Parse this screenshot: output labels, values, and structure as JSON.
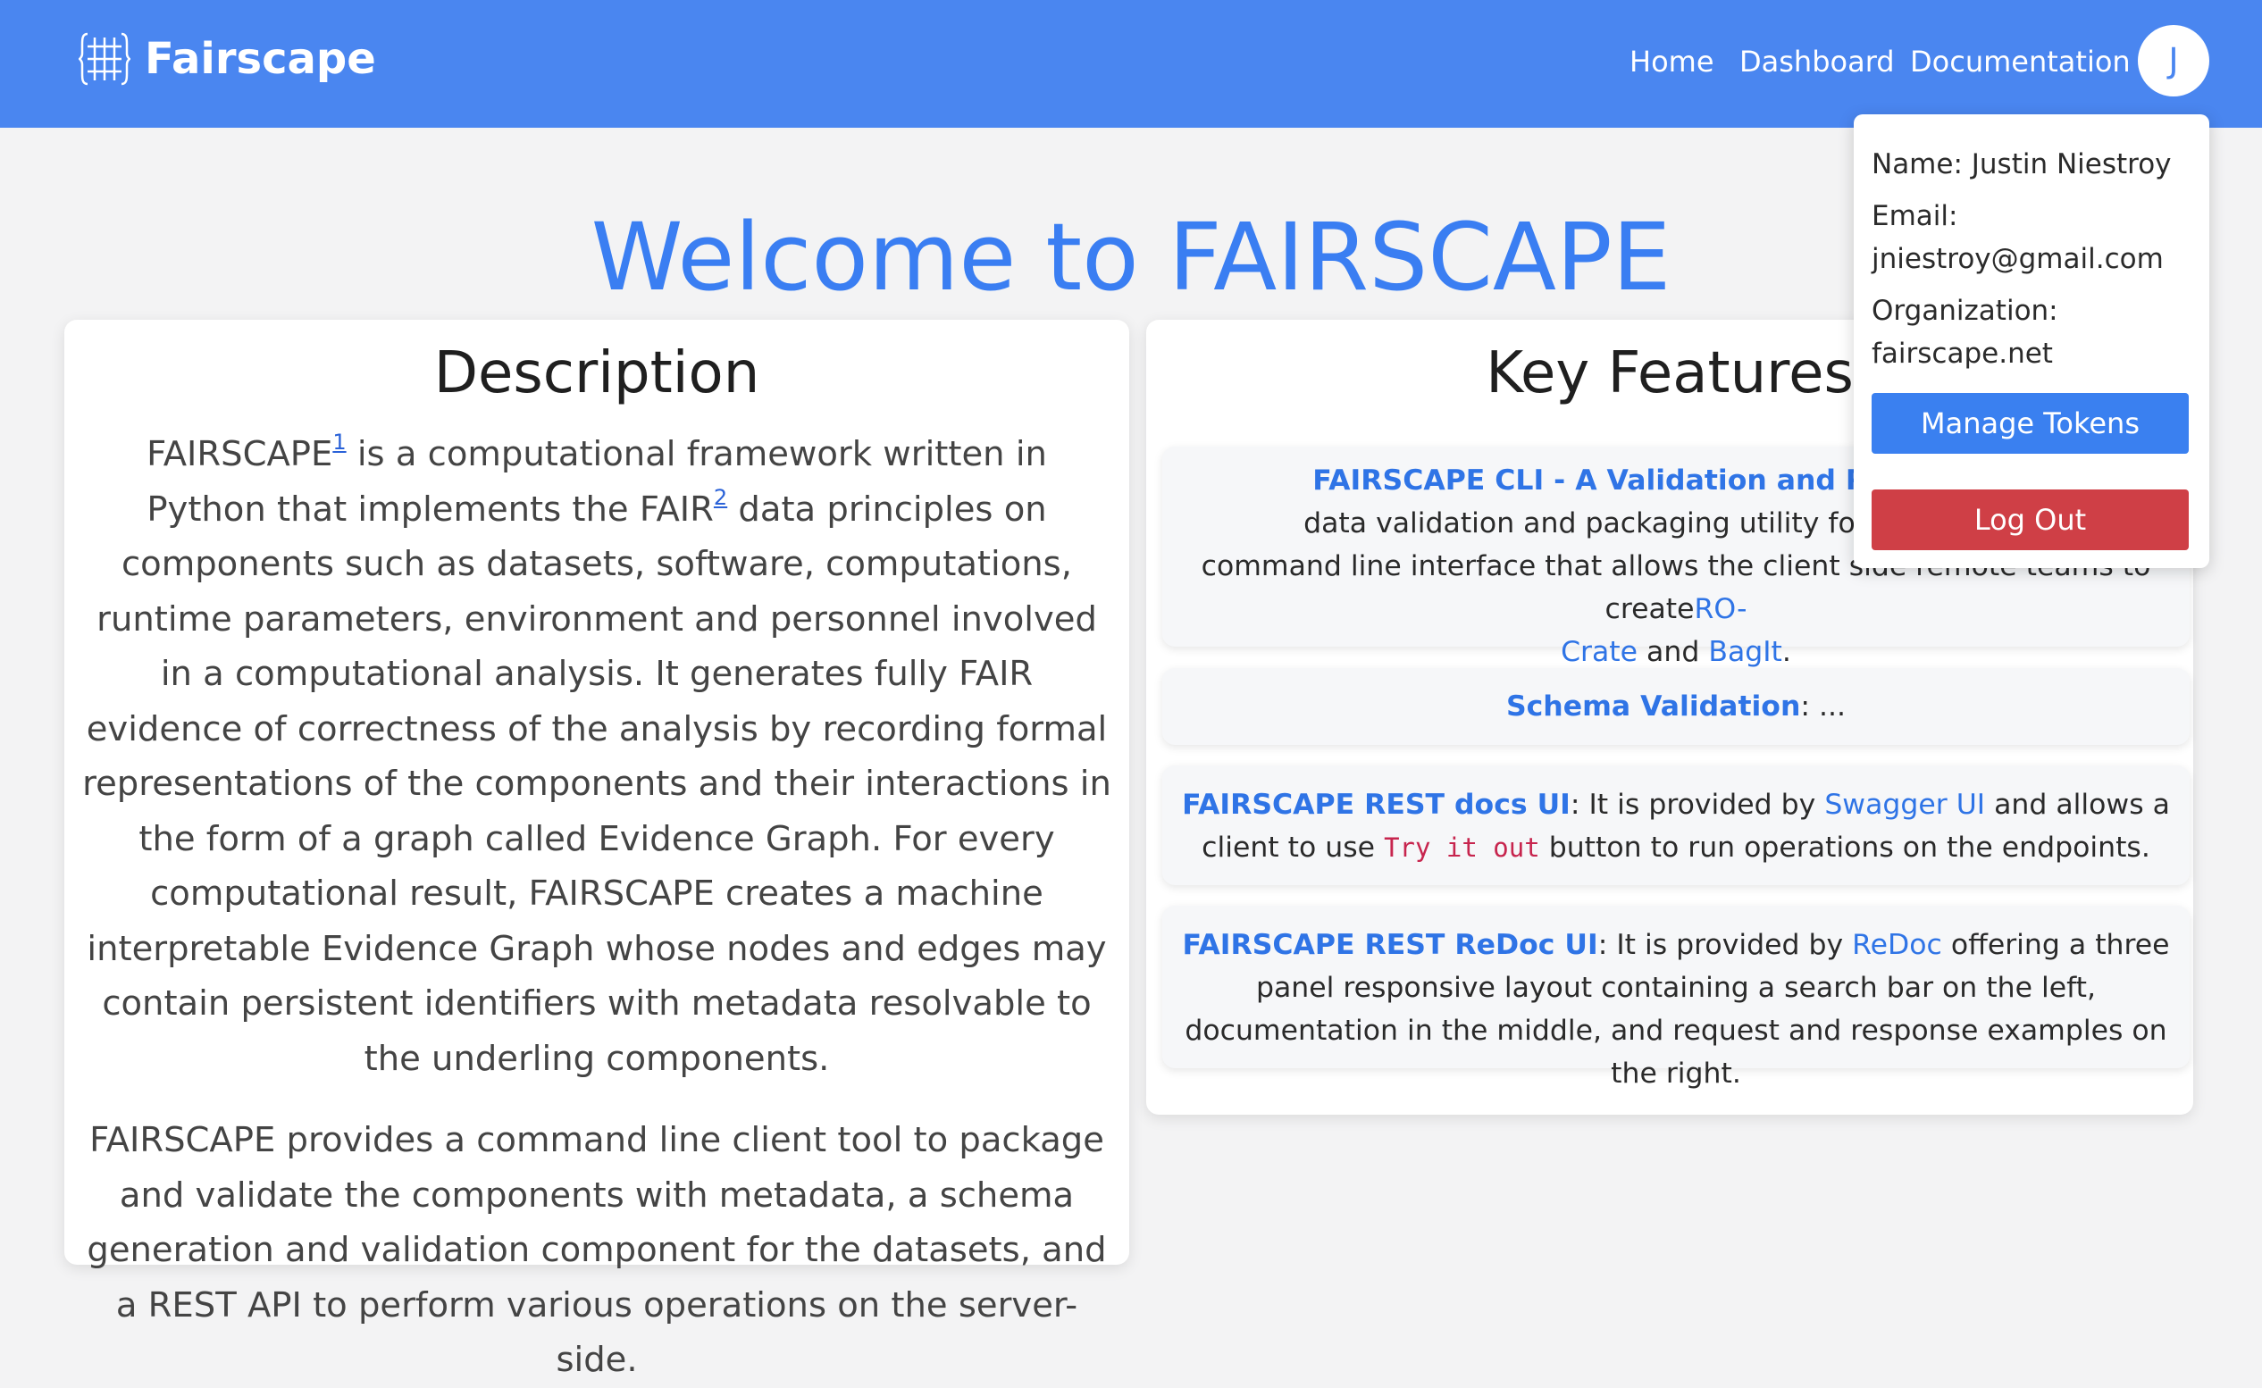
{
  "navbar": {
    "brand": "Fairscape",
    "links": [
      "Home",
      "Dashboard",
      "Documentation"
    ],
    "avatar_initial": "J"
  },
  "page": {
    "welcome": "Welcome to FAIRSCAPE"
  },
  "description": {
    "title": "Description",
    "p1_a": "FAIRSCAPE",
    "p1_sup1": "1",
    "p1_b": " is a computational framework written in Python that implements the FAIR",
    "p1_sup2": "2",
    "p1_c": " data principles on components such as datasets, software, computations, runtime parameters, environment and personnel involved in a computational analysis. It generates fully FAIR evidence of correctness of the analysis by recording formal representations of the components and their interactions in the form of a graph called Evidence Graph. For every computational result, FAIRSCAPE creates a machine interpretable Evidence Graph whose nodes and edges may contain persistent identifiers with metadata resolvable to the underling components.",
    "p2": "FAIRSCAPE provides a command line client tool to package and validate the components with metadata, a schema generation and validation component for the datasets, and a REST API to perform various operations on the server-side."
  },
  "features": {
    "title": "Key Features",
    "cli": {
      "title": "FAIRSCAPE CLI - A Validation and Packaging C",
      "line1": "data validation and packaging utility for the FAIRSCA",
      "line2": "command line interface that allows the client side remote teams to create",
      "link_rocrate_a": "RO-",
      "link_rocrate_b": "Crate",
      "and": " and ",
      "link_bagit": "BagIt",
      "end": "."
    },
    "schema": {
      "title": "Schema Validation",
      "text": ": ..."
    },
    "docs": {
      "title": "FAIRSCAPE REST docs UI",
      "text_a": ": It is provided by ",
      "link": "Swagger UI",
      "text_b": " and allows a client to use ",
      "code": "Try it out",
      "text_c": " button to run operations on the endpoints."
    },
    "redoc": {
      "title": "FAIRSCAPE REST ReDoc UI",
      "text_a": ": It is provided by ",
      "link": "ReDoc",
      "text_b": " offering a three panel responsive layout containing a search bar on the left, documentation in the middle, and request and response examples on the right."
    }
  },
  "user_menu": {
    "name": "Name: Justin Niestroy",
    "email_label": "Email:",
    "email": "jniestroy@gmail.com",
    "org_label": "Organization:",
    "org": "fairscape.net",
    "manage_tokens": "Manage Tokens",
    "logout": "Log Out"
  },
  "colors": {
    "navbar": "#4a86f0",
    "accent": "#3a7ef2",
    "link": "#2f74e6",
    "logout": "#cf3f46",
    "background": "#f3f3f4"
  }
}
